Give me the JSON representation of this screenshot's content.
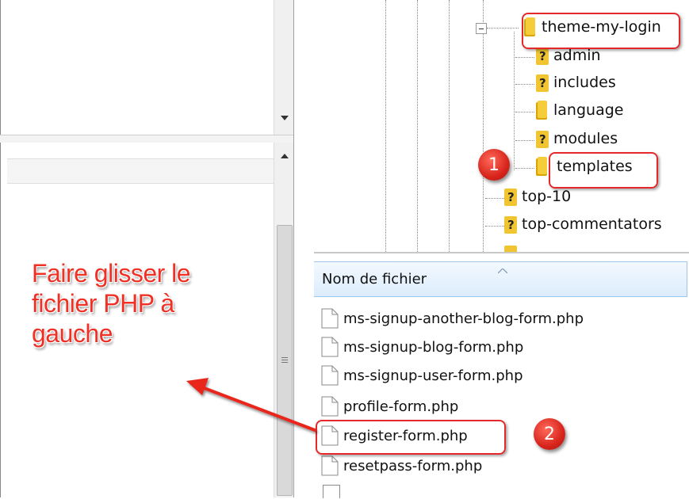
{
  "tree": {
    "items": [
      {
        "label": "theme-my-login",
        "icon": "folder-icon",
        "expander": "⊟"
      },
      {
        "label": "admin",
        "icon": "unknown-folder-icon"
      },
      {
        "label": "includes",
        "icon": "unknown-folder-icon"
      },
      {
        "label": "language",
        "icon": "folder-icon"
      },
      {
        "label": "modules",
        "icon": "unknown-folder-icon"
      },
      {
        "label": "templates",
        "icon": "folder-icon"
      },
      {
        "label": "top-10",
        "icon": "unknown-folder-icon"
      },
      {
        "label": "top-commentators",
        "icon": "unknown-folder-icon"
      }
    ]
  },
  "file_list": {
    "column_header": "Nom de fichier",
    "files": [
      "ms-signup-another-blog-form.php",
      "ms-signup-blog-form.php",
      "ms-signup-user-form.php",
      "profile-form.php",
      "register-form.php",
      "resetpass-form.php"
    ]
  },
  "annotations": {
    "badge_1": "1",
    "badge_2": "2",
    "instruction_line1": "Faire glisser le",
    "instruction_line2": "fichier PHP à",
    "instruction_line3": "gauche",
    "highlight_color": "#e5292b"
  }
}
